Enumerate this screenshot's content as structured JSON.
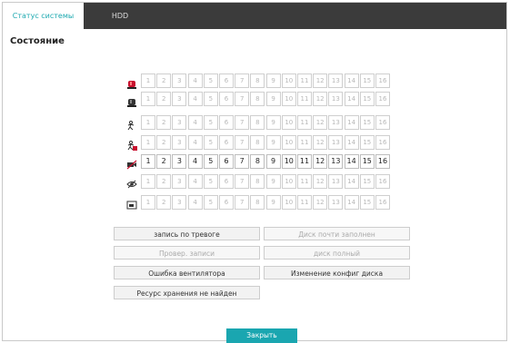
{
  "tabs": [
    {
      "label": "Статус системы",
      "active": true
    },
    {
      "label": "HDD",
      "active": false
    }
  ],
  "section_title": "Состояние",
  "channels": [
    "1",
    "2",
    "3",
    "4",
    "5",
    "6",
    "7",
    "8",
    "9",
    "10",
    "11",
    "12",
    "13",
    "14",
    "15",
    "16"
  ],
  "rows": [
    {
      "icon": "alarm-siren-icon",
      "active": false
    },
    {
      "icon": "alarm-output-icon",
      "active": false
    },
    {
      "icon": "motion-detect-icon",
      "active": false
    },
    {
      "icon": "motion-alarm-icon",
      "active": false
    },
    {
      "icon": "video-loss-icon",
      "active": true
    },
    {
      "icon": "video-blind-icon",
      "active": false
    },
    {
      "icon": "recording-icon",
      "active": false
    }
  ],
  "buttons": [
    {
      "label": "запись по тревоге",
      "disabled": false
    },
    {
      "label": "Диск почти заполнен",
      "disabled": true
    },
    {
      "label": "Провер. записи",
      "disabled": true
    },
    {
      "label": "диск полный",
      "disabled": true
    },
    {
      "label": "Ошибка вентилятора",
      "disabled": false
    },
    {
      "label": "Изменение конфиг диска",
      "disabled": false
    },
    {
      "label": "Ресурс хранения не найден",
      "disabled": false
    }
  ],
  "close_label": "Закрыть",
  "colors": {
    "accent": "#1aa6b0",
    "tabbar": "#3b3b3b",
    "alarm_red": "#c8102e"
  }
}
